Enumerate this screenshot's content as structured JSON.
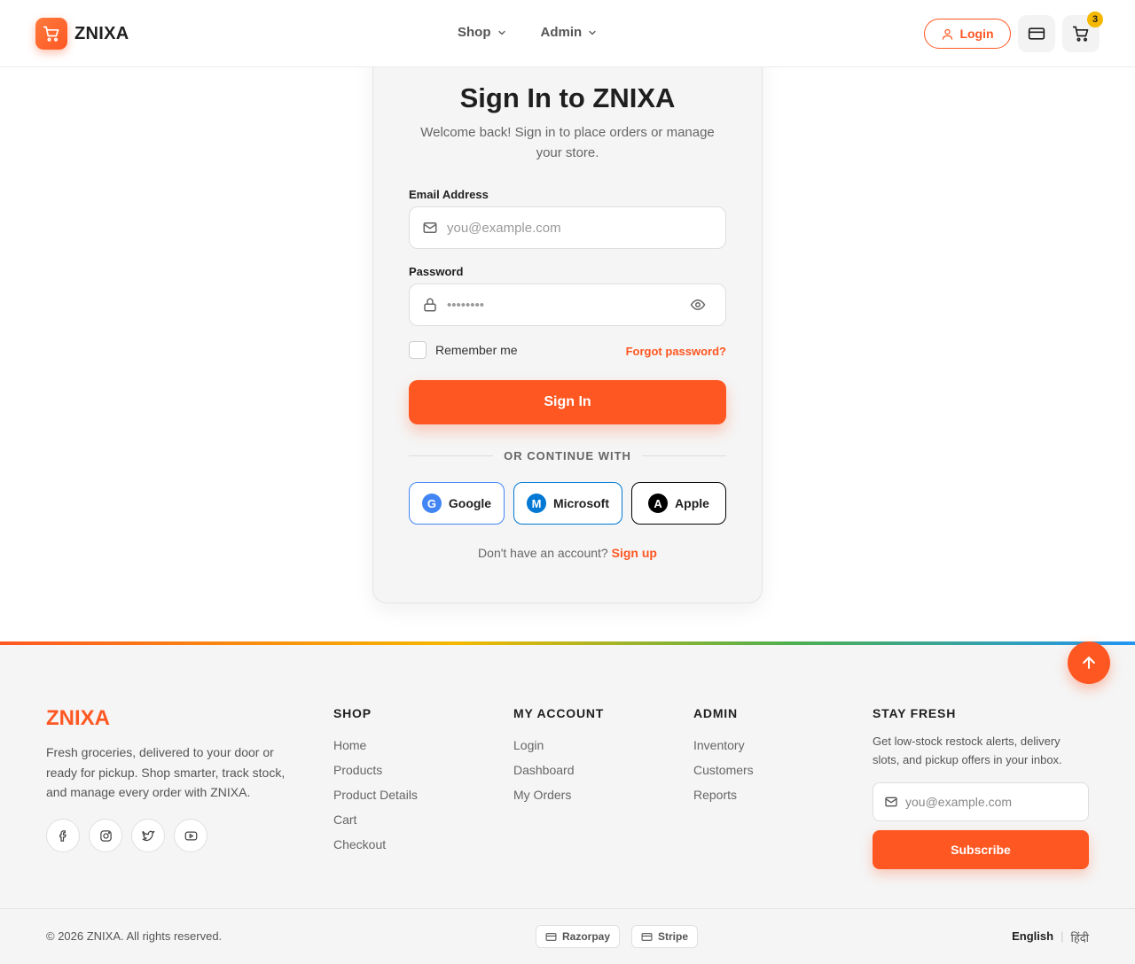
{
  "header": {
    "brand": "ZNIXA",
    "nav": [
      {
        "label": "Shop"
      },
      {
        "label": "Admin"
      }
    ],
    "login_label": "Login",
    "cart_count": "3"
  },
  "signin": {
    "title": "Sign In to ZNIXA",
    "subtitle": "Welcome back! Sign in to place orders or manage your store.",
    "email_label": "Email Address",
    "email_placeholder": "you@example.com",
    "password_label": "Password",
    "password_placeholder": "••••••••",
    "remember_label": "Remember me",
    "forgot_label": "Forgot password?",
    "submit_label": "Sign In",
    "divider_label": "OR CONTINUE WITH",
    "social": [
      {
        "label": "Google",
        "letter": "G",
        "color": "#4285f4",
        "border": "#4285f4"
      },
      {
        "label": "Microsoft",
        "letter": "M",
        "color": "#0078d4",
        "border": "#0078d4"
      },
      {
        "label": "Apple",
        "letter": "A",
        "color": "#000000",
        "border": "#000000"
      }
    ],
    "no_account": "Don't have an account?",
    "signup_label": "Sign up"
  },
  "footer": {
    "brand": "ZNIXA",
    "description": "Fresh groceries, delivered to your door or ready for pickup. Shop smarter, track stock, and manage every order with ZNIXA.",
    "columns": [
      {
        "heading": "SHOP",
        "links": [
          "Home",
          "Products",
          "Product Details",
          "Cart",
          "Checkout"
        ]
      },
      {
        "heading": "MY ACCOUNT",
        "links": [
          "Login",
          "Dashboard",
          "My Orders"
        ]
      },
      {
        "heading": "ADMIN",
        "links": [
          "Inventory",
          "Customers",
          "Reports"
        ]
      }
    ],
    "stay": {
      "heading": "STAY FRESH",
      "description": "Get low-stock restock alerts, delivery slots, and pickup offers in your inbox.",
      "placeholder": "you@example.com",
      "button": "Subscribe"
    },
    "copyright": "© 2026 ZNIXA. All rights reserved.",
    "payments": [
      "Razorpay",
      "Stripe"
    ],
    "languages": [
      "English",
      "हिंदी"
    ]
  },
  "colors": {
    "accent": "#ff5722",
    "badge": "#f5b800"
  }
}
